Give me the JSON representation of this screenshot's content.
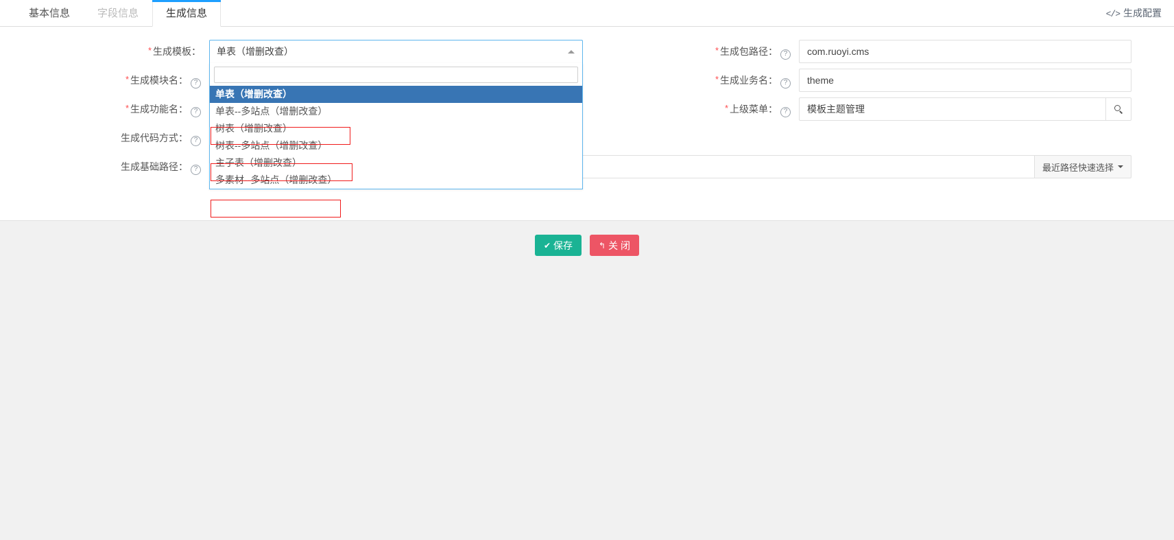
{
  "tabs": [
    {
      "label": "基本信息",
      "state": "plain"
    },
    {
      "label": "字段信息",
      "state": "dim"
    },
    {
      "label": "生成信息",
      "state": "active"
    }
  ],
  "header": {
    "gen_config_label": "生成配置",
    "code_icon": "</>"
  },
  "form": {
    "left": [
      {
        "label": "生成模板：",
        "required": true,
        "help": false
      },
      {
        "label": "生成模块名：",
        "required": true,
        "help": true
      },
      {
        "label": "生成功能名：",
        "required": true,
        "help": true
      },
      {
        "label": "生成代码方式：",
        "required": false,
        "help": true
      },
      {
        "label": "生成基础路径：",
        "required": false,
        "help": true
      }
    ],
    "right": [
      {
        "label": "生成包路径：",
        "required": true,
        "help": true,
        "value": "com.ruoyi.cms"
      },
      {
        "label": "生成业务名：",
        "required": true,
        "help": true,
        "value": "theme"
      },
      {
        "label": "上级菜单：",
        "required": true,
        "help": true,
        "value": "模板主题管理"
      }
    ],
    "quick_path_button": "最近路径快速选择"
  },
  "template_select": {
    "selected": "单表（增删改查）",
    "search_placeholder": "",
    "search_value": "",
    "options": [
      {
        "label": "单表（增删改查）",
        "highlighted": true,
        "annotated": false
      },
      {
        "label": "单表--多站点（增删改查）",
        "highlighted": false,
        "annotated": true
      },
      {
        "label": "树表（增删改查）",
        "highlighted": false,
        "annotated": false
      },
      {
        "label": "树表--多站点（增删改查）",
        "highlighted": false,
        "annotated": true
      },
      {
        "label": "主子表（增删改查）",
        "highlighted": false,
        "annotated": false
      },
      {
        "label": "多素材--多站点（增删改查）",
        "highlighted": false,
        "annotated": true
      }
    ]
  },
  "footer": {
    "save_label": "保存",
    "save_icon": "✔",
    "close_label": "关 闭",
    "close_icon": "↰"
  },
  "colors": {
    "accent": "#1E9FFF",
    "select_border": "#5eb6ee",
    "option_highlight": "#3875b4",
    "annotation": "#f01a1a",
    "save": "#1ab394",
    "close": "#ed5565",
    "required": "#ff4d4f"
  }
}
